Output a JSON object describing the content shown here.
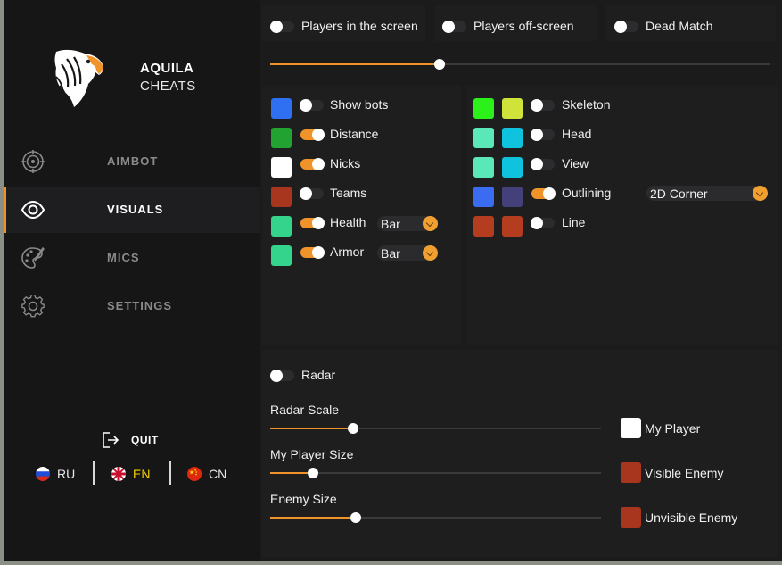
{
  "brand": {
    "name": "AQUILA",
    "subtitle": "CHEATS"
  },
  "nav": {
    "aimbot": {
      "label": "AIMBOT",
      "icon": "crosshair-icon"
    },
    "visuals": {
      "label": "VISUALS",
      "icon": "eye-icon"
    },
    "mics": {
      "label": "MICS",
      "icon": "palette-icon"
    },
    "settings": {
      "label": "SETTINGS",
      "icon": "gear-icon"
    }
  },
  "quit": {
    "label": "QUIT",
    "icon": "exit-icon"
  },
  "languages": {
    "ru": {
      "label": "RU"
    },
    "en": {
      "label": "EN",
      "active": true
    },
    "cn": {
      "label": "CN"
    }
  },
  "top_toggles": {
    "players_in_screen": {
      "label": "Players in the screen",
      "on": false
    },
    "players_off_screen": {
      "label": "Players off-screen",
      "on": false
    },
    "dead_match": {
      "label": "Dead Match",
      "on": false
    }
  },
  "top_slider_value": 0.34,
  "left_options": {
    "show_bots": {
      "label": "Show bots",
      "on": false,
      "color": "#2f6ff2"
    },
    "distance": {
      "label": "Distance",
      "on": true,
      "color": "#22a331"
    },
    "nicks": {
      "label": "Nicks",
      "on": true,
      "color": "#ffffff"
    },
    "teams": {
      "label": "Teams",
      "on": false,
      "color": "#a8361f"
    },
    "health": {
      "label": "Health",
      "on": true,
      "color": "#34d48c",
      "mode": "Bar"
    },
    "armor": {
      "label": "Armor",
      "on": true,
      "color": "#34d48c",
      "mode": "Bar"
    }
  },
  "right_options": {
    "skeleton": {
      "label": "Skeleton",
      "on": false,
      "color1": "#2cf01a",
      "color2": "#d0e33a"
    },
    "head": {
      "label": "Head",
      "on": false,
      "color1": "#5be8b9",
      "color2": "#0fc2dd"
    },
    "view": {
      "label": "View",
      "on": false,
      "color1": "#5be8b9",
      "color2": "#0fc2dd"
    },
    "outlining": {
      "label": "Outlining",
      "on": true,
      "color1": "#3a6bf0",
      "color2": "#43407a",
      "mode": "2D Corner"
    },
    "line": {
      "label": "Line",
      "on": false,
      "color1": "#b43c1f",
      "color2": "#b43c1f"
    }
  },
  "radar": {
    "label": "Radar",
    "on": false,
    "radar_scale": {
      "label": "Radar Scale",
      "value": 0.25
    },
    "my_player_size": {
      "label": "My Player Size",
      "value": 0.13
    },
    "enemy_size": {
      "label": "Enemy Size",
      "value": 0.26
    }
  },
  "radar_colors": {
    "my_player": {
      "label": "My Player",
      "color": "#ffffff"
    },
    "visible_enemy": {
      "label": "Visible Enemy",
      "color": "#a8361f"
    },
    "unvisible_enemy": {
      "label": "Unvisible Enemy",
      "color": "#a8361f"
    }
  }
}
